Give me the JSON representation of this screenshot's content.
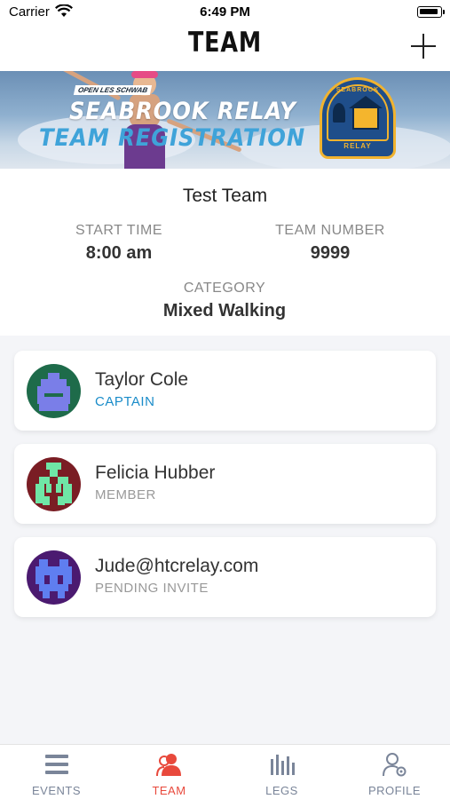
{
  "status_bar": {
    "carrier": "Carrier",
    "time": "6:49 PM"
  },
  "nav": {
    "title": "TEAM"
  },
  "banner": {
    "tagline": "OPEN LES SCHWAB",
    "title_line1": "SEABROOK RELAY",
    "title_line2": "TEAM REGISTRATION",
    "badge_top": "SEABROOK",
    "badge_bottom": "RELAY"
  },
  "team": {
    "name": "Test Team",
    "start_time_label": "START TIME",
    "start_time": "8:00 am",
    "team_number_label": "TEAM NUMBER",
    "team_number": "9999",
    "category_label": "CATEGORY",
    "category": "Mixed Walking"
  },
  "members": [
    {
      "name": "Taylor Cole",
      "role": "CAPTAIN",
      "avatar_bg": "#1e6b4a",
      "avatar_fg": "#7a7ee8"
    },
    {
      "name": "Felicia Hubber",
      "role": "MEMBER",
      "avatar_bg": "#7a1d24",
      "avatar_fg": "#6fe6a6"
    },
    {
      "name": "Jude@htcrelay.com",
      "role": "PENDING INVITE",
      "avatar_bg": "#4b1a70",
      "avatar_fg": "#5f7ef0"
    }
  ],
  "tabs": [
    {
      "label": "EVENTS",
      "icon": "list-icon",
      "active": false
    },
    {
      "label": "TEAM",
      "icon": "team-icon",
      "active": true
    },
    {
      "label": "LEGS",
      "icon": "bars-icon",
      "active": false
    },
    {
      "label": "PROFILE",
      "icon": "profile-settings-icon",
      "active": false
    }
  ],
  "colors": {
    "accent_active": "#e8493c",
    "captain": "#1a8cc9",
    "tab_inactive": "#7a8599"
  }
}
